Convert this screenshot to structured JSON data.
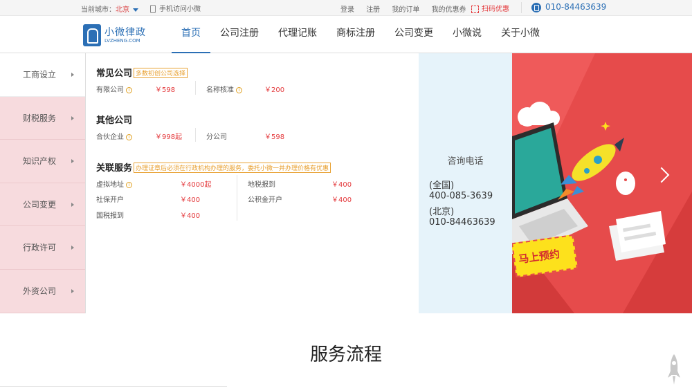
{
  "topbar": {
    "city_label": "当前城市：",
    "city_name": "北京",
    "mobile": "手机访问小微",
    "links": [
      "登录",
      "注册",
      "我的订单",
      "我的优惠券"
    ],
    "scan": "扫码优惠",
    "tel": "010-84463639"
  },
  "logo": {
    "name": "小微律政",
    "sub": "LVZHENG.COM"
  },
  "nav": [
    "首页",
    "公司注册",
    "代理记账",
    "商标注册",
    "公司变更",
    "小微说",
    "关于小微"
  ],
  "sidebar": [
    "工商设立",
    "财税服务",
    "知识产权",
    "公司变更",
    "行政许可",
    "外资公司"
  ],
  "groups": {
    "common": {
      "title": "常见公司",
      "tag": "多数初创公司选择",
      "items": [
        {
          "label": "有限公司",
          "price": "￥598"
        },
        {
          "label": "名称核准",
          "price": "￥200"
        }
      ]
    },
    "other": {
      "title": "其他公司",
      "items": [
        {
          "label": "合伙企业",
          "price": "￥998起"
        },
        {
          "label": "分公司",
          "price": "￥598"
        }
      ]
    },
    "related": {
      "title": "关联服务",
      "tag": "办理证章后必须在行政机构办理的服务，委托小微一并办理价格有优惠",
      "items": [
        {
          "label": "虚拟地址",
          "price": "￥4000起"
        },
        {
          "label": "地税报到",
          "price": "￥400"
        },
        {
          "label": "社保开户",
          "price": "￥400"
        },
        {
          "label": "公积金开户",
          "price": "￥400"
        },
        {
          "label": "国税报到",
          "price": "￥400"
        }
      ]
    }
  },
  "consult": {
    "title": "咨询电话",
    "lines": [
      "(全国)",
      "400-085-3639",
      "(北京)",
      "010-84463639"
    ]
  },
  "banner": {
    "stamp": "马上预约"
  },
  "section_title": "服务流程",
  "colors": {
    "brand": "#2b6fb5",
    "price": "#e4393c",
    "banner": "#e64b4b"
  }
}
